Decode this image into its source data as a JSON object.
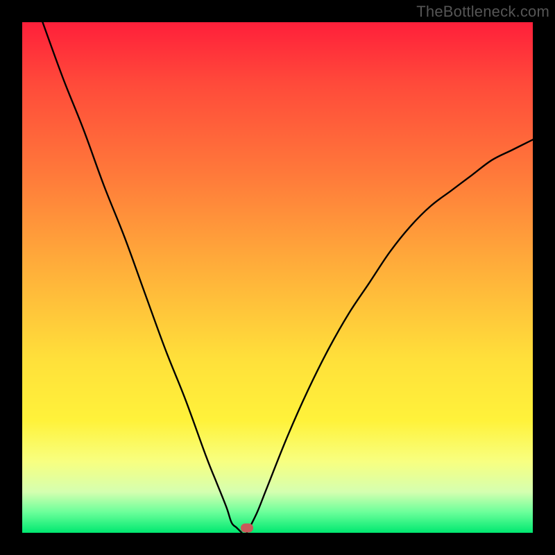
{
  "watermark": "TheBottleneck.com",
  "chart_data": {
    "type": "line",
    "title": "",
    "xlabel": "",
    "ylabel": "",
    "xlim": [
      0,
      100
    ],
    "ylim": [
      0,
      100
    ],
    "legend": false,
    "grid": false,
    "background_gradient": {
      "direction": "vertical",
      "stops": [
        {
          "pos": 0.0,
          "color": "#ff1f3a"
        },
        {
          "pos": 0.12,
          "color": "#ff4a3a"
        },
        {
          "pos": 0.3,
          "color": "#ff7a3a"
        },
        {
          "pos": 0.48,
          "color": "#ffae3a"
        },
        {
          "pos": 0.66,
          "color": "#ffe03a"
        },
        {
          "pos": 0.78,
          "color": "#fff23a"
        },
        {
          "pos": 0.86,
          "color": "#f8ff80"
        },
        {
          "pos": 0.92,
          "color": "#d5ffb0"
        },
        {
          "pos": 0.96,
          "color": "#6aff9a"
        },
        {
          "pos": 1.0,
          "color": "#00e870"
        }
      ]
    },
    "series": [
      {
        "name": "bottleneck-left",
        "color": "#000000",
        "x": [
          4,
          8,
          12,
          16,
          20,
          24,
          28,
          32,
          36,
          38,
          40,
          41,
          42,
          43
        ],
        "y": [
          100,
          89,
          79,
          68,
          58,
          47,
          36,
          26,
          15,
          10,
          5,
          2,
          1,
          0
        ]
      },
      {
        "name": "bottleneck-right",
        "color": "#000000",
        "x": [
          44,
          46,
          48,
          52,
          56,
          60,
          64,
          68,
          72,
          76,
          80,
          84,
          88,
          92,
          96,
          100
        ],
        "y": [
          0,
          4,
          9,
          19,
          28,
          36,
          43,
          49,
          55,
          60,
          64,
          67,
          70,
          73,
          75,
          77
        ]
      }
    ],
    "marker": {
      "x": 44,
      "y": 1,
      "color": "#c85a5a",
      "shape": "pill"
    }
  }
}
